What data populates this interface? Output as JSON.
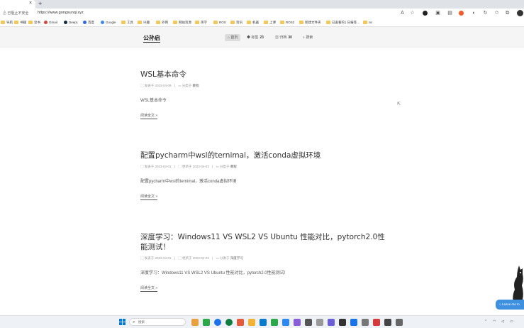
{
  "browser": {
    "tab_close": "×",
    "new_tab": "+",
    "security_label": "已阻止不安全",
    "url": "https://www.gongsunqi.xyz"
  },
  "bookmarks": [
    {
      "label": "导航",
      "type": "folder"
    },
    {
      "label": "书籍",
      "type": "folder"
    },
    {
      "label": "读书",
      "type": "folder"
    },
    {
      "label": "Gmail",
      "type": "site",
      "color": "#d44638"
    },
    {
      "label": "DeepL",
      "type": "site",
      "color": "#0f2b46"
    },
    {
      "label": "百度",
      "type": "site",
      "color": "#3068e0"
    },
    {
      "label": "Google",
      "type": "site",
      "color": "#4285f4"
    },
    {
      "label": "工具",
      "type": "folder"
    },
    {
      "label": "兴趣",
      "type": "folder"
    },
    {
      "label": "外网",
      "type": "folder"
    },
    {
      "label": "网站资源",
      "type": "folder"
    },
    {
      "label": "英学",
      "type": "folder"
    },
    {
      "label": "ROS",
      "type": "folder"
    },
    {
      "label": "资讯",
      "type": "folder"
    },
    {
      "label": "机器",
      "type": "folder"
    },
    {
      "label": "上课",
      "type": "folder"
    },
    {
      "label": "ROS2",
      "type": "folder"
    },
    {
      "label": "新建文件夹",
      "type": "folder"
    },
    {
      "label": "已查看的 | 日报等…",
      "type": "folder"
    },
    {
      "label": "nn",
      "type": "folder"
    }
  ],
  "site": {
    "brand": "公孙启",
    "nav": [
      {
        "label": "首页",
        "count": "",
        "icon": "home-icon",
        "active": true
      },
      {
        "label": "标签",
        "count": "23",
        "icon": "tag-icon",
        "active": false
      },
      {
        "label": "归档",
        "count": "30",
        "icon": "archive-icon",
        "active": false
      },
      {
        "label": "搜索",
        "count": "",
        "icon": "search-icon",
        "active": false
      }
    ]
  },
  "posts": [
    {
      "title": "WSL基本命令",
      "published_label": "发表于",
      "published": "2023-04-09",
      "updated_label": "",
      "updated": "",
      "category_label": "分类于",
      "category": "教程",
      "excerpt": "WSL基本命令",
      "read_more": "阅读全文 »"
    },
    {
      "title": "配置pycharm中wsl的ternimal，激活conda虚拟环境",
      "published_label": "发表于",
      "published": "2023-04-01",
      "updated_label": "更新于",
      "updated": "2023-04-03",
      "category_label": "分类于",
      "category": "教程",
      "excerpt": "配置pycharm中wsl的ternimal，激活conda虚拟环境",
      "read_more": "阅读全文 »"
    },
    {
      "title": "深度学习：Windows11 VS WSL2 VS Ubuntu 性能对比，pytorch2.0性能测试！",
      "published_label": "发表于",
      "published": "2023-04-01",
      "updated_label": "更新于",
      "updated": "2023-04-03",
      "category_label": "分类于",
      "category": "深度学习",
      "excerpt": "深度学习：Windows11 VS WSL2 VS Ubuntu 性能对比，pytorch2.0性能测试!",
      "read_more": "阅读全文 »"
    }
  ],
  "chat_widget": {
    "label": "Leave me m"
  },
  "taskbar": {
    "search_placeholder": "搜索",
    "app_colors": [
      "#e8a040",
      "#1a73e8",
      "#2ca84a",
      "#e35a3c",
      "#0a7acc",
      "#8a5cd6",
      "#f2b233",
      "#0e7d3f",
      "#d63b3b",
      "#2d89ef"
    ]
  }
}
